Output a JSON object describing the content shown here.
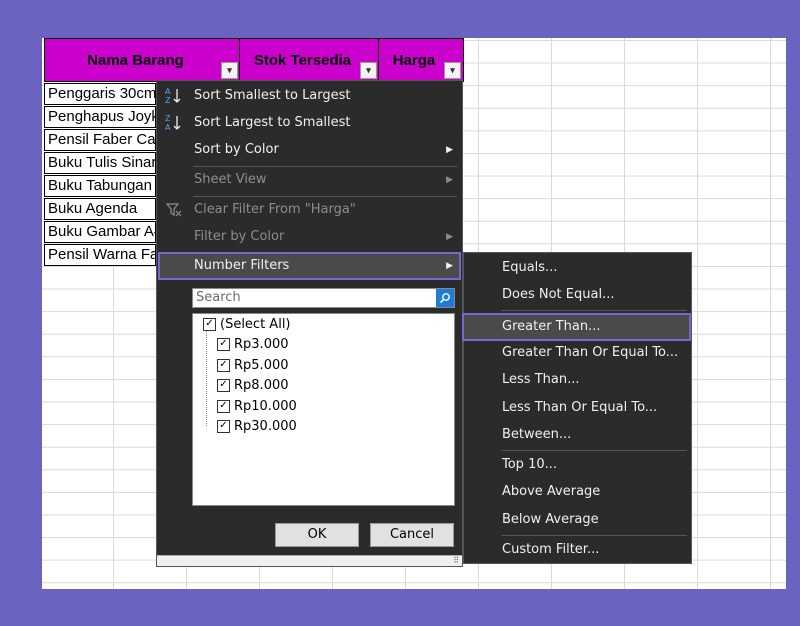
{
  "table": {
    "headers": [
      "Nama Barang",
      "Stok Tersedia",
      "Harga"
    ],
    "rows": [
      "Penggaris 30cm",
      "Penghapus Joyko",
      "Pensil Faber Castell",
      "Buku Tulis Sinar Dunia",
      "Buku Tabungan",
      "Buku Agenda",
      "Buku Gambar A4",
      "Pensil Warna Faber"
    ]
  },
  "menu": {
    "sort_asc": "Sort Smallest to Largest",
    "sort_desc": "Sort Largest to Smallest",
    "sort_color": "Sort by Color",
    "sheet_view": "Sheet View",
    "clear_filter": "Clear Filter From \"Harga\"",
    "filter_color": "Filter by Color",
    "number_filters": "Number Filters",
    "search_placeholder": "Search",
    "values": [
      "(Select All)",
      "Rp3.000",
      "Rp5.000",
      "Rp8.000",
      "Rp10.000",
      "Rp30.000"
    ],
    "ok": "OK",
    "cancel": "Cancel"
  },
  "submenu": {
    "equals": "Equals...",
    "not_equal": "Does Not Equal...",
    "greater": "Greater Than...",
    "greater_equal": "Greater Than Or Equal To...",
    "less": "Less Than...",
    "less_equal": "Less Than Or Equal To...",
    "between": "Between...",
    "top10": "Top 10...",
    "above_avg": "Above Average",
    "below_avg": "Below Average",
    "custom": "Custom Filter..."
  },
  "colors": {
    "background": "#6b63c0",
    "header_fill": "#cc00cc",
    "menu_bg": "#2b2b2b",
    "highlight_outline": "#6e69d4"
  },
  "icons": [
    "sort-ascending-icon",
    "sort-descending-icon",
    "clear-filter-icon",
    "search-icon",
    "chevron-right-icon",
    "dropdown-arrow-icon",
    "checkbox-icon"
  ]
}
